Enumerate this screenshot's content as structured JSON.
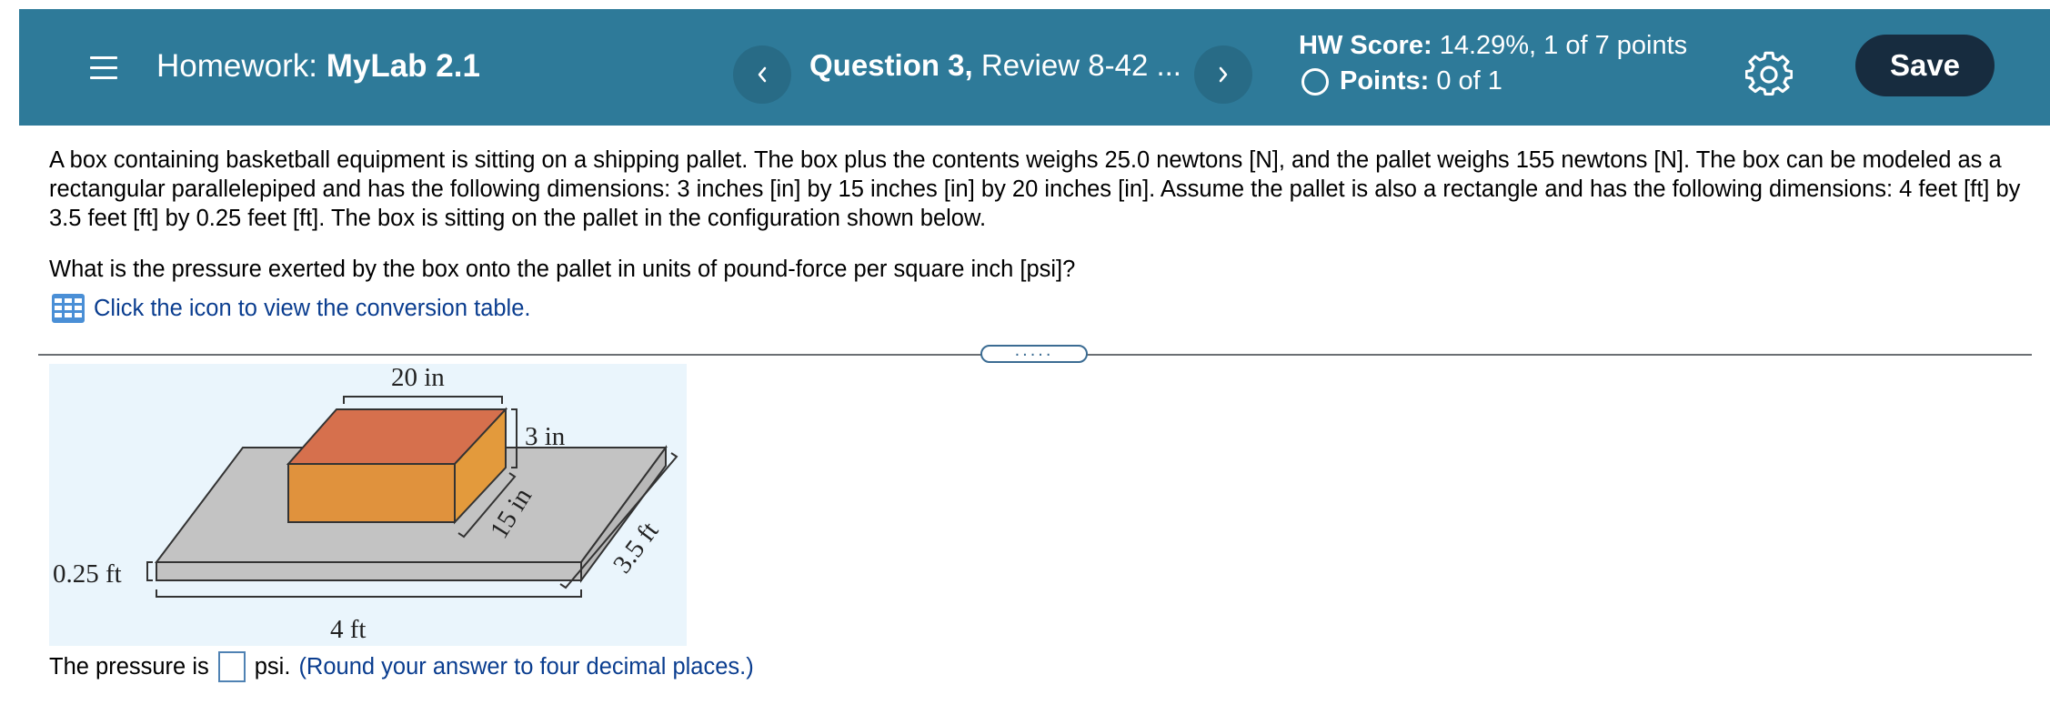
{
  "header": {
    "hw_prefix": "Homework:",
    "hw_name": "MyLab 2.1",
    "question_bold": "Question 3,",
    "question_rest": "Review 8-42 ...",
    "score_label": "HW Score:",
    "score_value": "14.29%, 1 of 7 points",
    "points_label": "Points:",
    "points_value": "0 of 1",
    "save_label": "Save",
    "colors": {
      "bar": "#2e7a99",
      "save": "#172c3f"
    }
  },
  "problem": {
    "text": "A box containing basketball equipment is sitting on a shipping pallet. The box plus the contents weighs 25.0 newtons [N], and the pallet weighs 155 newtons [N]. The box can be modeled as a rectangular parallelepiped and has the following dimensions: 3 inches [in] by 15 inches [in] by 20 inches [in]. Assume the pallet is also a rectangle and has the following dimensions: 4 feet [ft] by 3.5 feet [ft] by 0.25 feet [ft]. The box is sitting on the pallet in the configuration shown below.",
    "question": "What is the pressure exerted by the box onto the pallet in units of pound-force per square inch [psi]?",
    "table_link": "Click the icon to view the conversion table."
  },
  "figure": {
    "label_20in": "20 in",
    "label_3in": "3 in",
    "label_15in": "15 in",
    "label_35ft": "3.5 ft",
    "label_025ft": "0.25 ft",
    "label_4ft": "4 ft",
    "colors": {
      "box_top": "#d6704d",
      "box_front": "#e0923d",
      "box_side": "#e39a3c",
      "pallet": "#c3c3c3",
      "background": "#eaf5fc"
    }
  },
  "answer": {
    "prefix": "The pressure is",
    "unit": "psi.",
    "hint": "(Round your answer to four decimal places.)",
    "value": ""
  }
}
